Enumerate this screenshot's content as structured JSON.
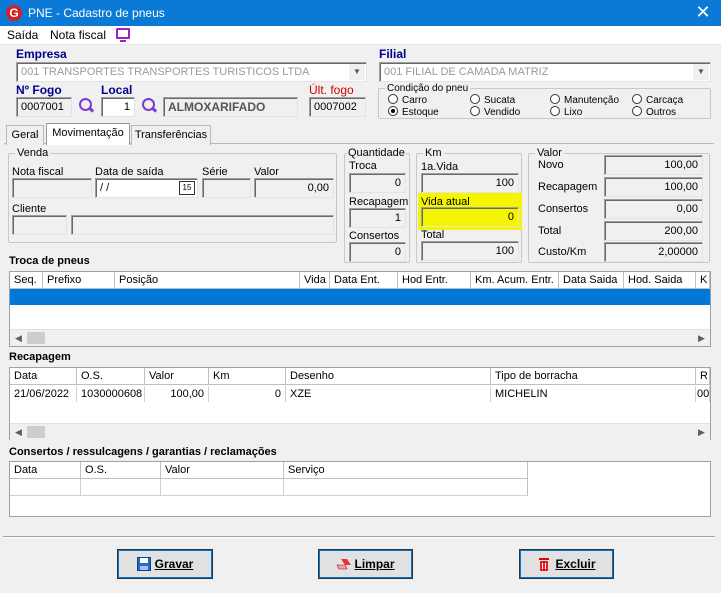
{
  "window": {
    "title": "PNE - Cadastro de pneus",
    "close": "✕",
    "logo": "G"
  },
  "menu": {
    "saida": "Saída",
    "nota_fiscal": "Nota fiscal"
  },
  "header": {
    "empresa_label": "Empresa",
    "empresa_value": "001  TRANSPORTES TRANSPORTES TURISTICOS LTDA",
    "filial_label": "Filial",
    "filial_value": "001  FILIAL DE CAMADA MATRIZ",
    "fogo_label": "Nº Fogo",
    "fogo_value": "0007001",
    "local_label": "Local",
    "local_value": "1",
    "local_name": "ALMOXARIFADO",
    "ult_fogo_label": "Últ. fogo",
    "ult_fogo_value": "0007002"
  },
  "condicao": {
    "label": "Condição do pneu",
    "options": [
      "Carro",
      "Estoque",
      "Sucata",
      "Vendido",
      "Manutenção",
      "Lixo",
      "Carcaça",
      "Outros"
    ],
    "selected": "Estoque"
  },
  "tabs": [
    "Geral",
    "Movimentação",
    "Transferências"
  ],
  "active_tab": "Movimentação",
  "venda": {
    "label": "Venda",
    "nota_fiscal_label": "Nota fiscal",
    "data_saida_label": "Data de saída",
    "data_saida_value": " / /",
    "calendar": "15",
    "serie_label": "Série",
    "valor_label": "Valor",
    "valor_value": "0,00",
    "cliente_label": "Cliente"
  },
  "quantidade": {
    "label": "Quantidade",
    "troca_label": "Troca",
    "troca_value": "0",
    "recapagem_label": "Recapagem",
    "recapagem_value": "1",
    "consertos_label": "Consertos",
    "consertos_value": "0"
  },
  "km": {
    "label": "Km",
    "primeira_vida_label": "1a.Vida",
    "primeira_vida_value": "100",
    "vida_atual_label": "Vida atual",
    "vida_atual_value": "0",
    "total_label": "Total",
    "total_value": "100"
  },
  "valor": {
    "label": "Valor",
    "novo_label": "Novo",
    "novo_value": "100,00",
    "recapagem_label": "Recapagem",
    "recapagem_value": "100,00",
    "consertos_label": "Consertos",
    "consertos_value": "0,00",
    "total_label": "Total",
    "total_value": "200,00",
    "custo_km_label": "Custo/Km",
    "custo_km_value": "2,00000"
  },
  "troca_grid": {
    "title": "Troca de pneus",
    "columns": [
      "Seq.",
      "Prefixo",
      "Posição",
      "Vida",
      "Data Ent.",
      "Hod Entr.",
      "Km. Acum. Entr.",
      "Data Saida",
      "Hod. Saida",
      "K"
    ]
  },
  "recap_grid": {
    "title": "Recapagem",
    "columns": [
      "Data",
      "O.S.",
      "Valor",
      "Km",
      "Desenho",
      "Tipo de borracha",
      "R"
    ],
    "rows": [
      [
        "21/06/2022",
        "1030000608",
        "100,00",
        "0",
        "XZE",
        "MICHELIN",
        "00"
      ]
    ]
  },
  "consertos_grid": {
    "title": "Consertos / ressulcagens / garantias / reclamações",
    "columns": [
      "Data",
      "O.S.",
      "Valor",
      "Serviço"
    ]
  },
  "buttons": {
    "gravar": "Gravar",
    "limpar": "Limpar",
    "excluir": "Excluir"
  },
  "colors": {
    "titlebar": "#0a7ad6",
    "label_blue": "#00008b",
    "selection": "#0078d7",
    "highlight": "#f5f500",
    "ult_fogo": "#d00000"
  }
}
